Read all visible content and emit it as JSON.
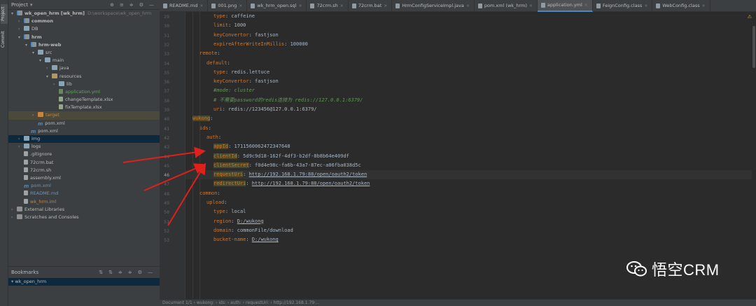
{
  "sidebar_strip": {
    "project_tab": "Project",
    "commit_tab": "Commit"
  },
  "project_panel": {
    "title": "Project",
    "tools": [
      "⊕",
      "≡",
      "≑",
      "⚙",
      "—"
    ],
    "tree": [
      {
        "depth": 0,
        "arrow": "▾",
        "icon": "folder mod",
        "label": "wk_open_hrm [wk_hrm]",
        "path": "D:\\workspace\\wk_open_hrm",
        "cls": "",
        "bold": true
      },
      {
        "depth": 1,
        "arrow": "›",
        "icon": "folder mod",
        "label": "common",
        "bold": true
      },
      {
        "depth": 1,
        "arrow": "›",
        "icon": "folder",
        "label": "DB"
      },
      {
        "depth": 1,
        "arrow": "▾",
        "icon": "folder mod",
        "label": "hrm",
        "bold": true
      },
      {
        "depth": 2,
        "arrow": "▾",
        "icon": "folder mod",
        "label": "hrm-web",
        "bold": true
      },
      {
        "depth": 3,
        "arrow": "▾",
        "icon": "folder",
        "label": "src"
      },
      {
        "depth": 4,
        "arrow": "▾",
        "icon": "folder",
        "label": "main"
      },
      {
        "depth": 5,
        "arrow": "›",
        "icon": "folder",
        "label": "java"
      },
      {
        "depth": 5,
        "arrow": "▾",
        "icon": "folder res",
        "label": "resources"
      },
      {
        "depth": 6,
        "arrow": "›",
        "icon": "folder",
        "label": "lib"
      },
      {
        "depth": 6,
        "arrow": "",
        "icon": "yml",
        "label": "application.yml",
        "cls": "green"
      },
      {
        "depth": 6,
        "arrow": "",
        "icon": "xlsx",
        "label": "changeTemplate.xlsx"
      },
      {
        "depth": 6,
        "arrow": "",
        "icon": "xlsx",
        "label": "fixTemplate.xlsx"
      },
      {
        "depth": 3,
        "arrow": "›",
        "icon": "folder orange",
        "label": "target",
        "cls": "orangeT",
        "row": "hl"
      },
      {
        "depth": 3,
        "arrow": "",
        "icon": "m",
        "label": "pom.xml"
      },
      {
        "depth": 2,
        "arrow": "",
        "icon": "m",
        "label": "pom.xml"
      },
      {
        "depth": 1,
        "arrow": "›",
        "icon": "folder",
        "label": "img",
        "row": "sel"
      },
      {
        "depth": 1,
        "arrow": "›",
        "icon": "folder",
        "label": "logs"
      },
      {
        "depth": 1,
        "arrow": "",
        "icon": "file",
        "label": ".gitignore"
      },
      {
        "depth": 1,
        "arrow": "",
        "icon": "file",
        "label": "72crm.bat"
      },
      {
        "depth": 1,
        "arrow": "",
        "icon": "file",
        "label": "72crm.sh"
      },
      {
        "depth": 1,
        "arrow": "",
        "icon": "file",
        "label": "assembly.xml"
      },
      {
        "depth": 1,
        "arrow": "",
        "icon": "m",
        "label": "pom.xml",
        "cls": "blue"
      },
      {
        "depth": 1,
        "arrow": "",
        "icon": "file",
        "label": "README.md",
        "cls": "blue"
      },
      {
        "depth": 1,
        "arrow": "",
        "icon": "file",
        "label": "wk_hrm.iml",
        "cls": "orangeT"
      },
      {
        "depth": 0,
        "arrow": "›",
        "icon": "lib",
        "label": "External Libraries"
      },
      {
        "depth": 0,
        "arrow": "›",
        "icon": "lib",
        "label": "Scratches and Consoles"
      }
    ]
  },
  "bookmarks": {
    "title": "Bookmarks",
    "tools": [
      "⇅",
      "⇅",
      "≑",
      "≑",
      "⚙",
      "—"
    ],
    "item": "wk_open_hrm"
  },
  "tabs": [
    {
      "label": "README.md",
      "active": false
    },
    {
      "label": "001.png",
      "active": false
    },
    {
      "label": "wk_hrm_open.sql",
      "active": false
    },
    {
      "label": "72crm.sh",
      "active": false
    },
    {
      "label": "72crm.bat",
      "active": false
    },
    {
      "label": "HrmConfigServiceImpl.java",
      "active": false
    },
    {
      "label": "pom.xml (wk_hrm)",
      "active": false
    },
    {
      "label": "application.yml",
      "active": true
    },
    {
      "label": "FeignConfig.class",
      "active": false
    },
    {
      "label": "WebConfig.class",
      "active": false
    }
  ],
  "editor": {
    "lines": [
      {
        "n": "29",
        "indent": 6,
        "key": "type",
        "val": "caffeine"
      },
      {
        "n": "30",
        "indent": 6,
        "key": "limit",
        "val": "1000"
      },
      {
        "n": "31",
        "indent": 6,
        "key": "keyConvertor",
        "val": "fastjson"
      },
      {
        "n": "32",
        "indent": 6,
        "key": "expireAfterWriteInMillis",
        "val": "100000"
      },
      {
        "n": "33",
        "indent": 2,
        "key": "remote",
        "val": ""
      },
      {
        "n": "34",
        "indent": 4,
        "key": "default",
        "val": ""
      },
      {
        "n": "35",
        "indent": 6,
        "key": "type",
        "val": "redis.lettuce"
      },
      {
        "n": "36",
        "indent": 6,
        "key": "keyConvertor",
        "val": "fastjson"
      },
      {
        "n": "37",
        "indent": 6,
        "comment": "#mode: cluster"
      },
      {
        "n": "38",
        "indent": 6,
        "comment": "# 不需要password的redis连接为 redis://127.0.0.1:6379/"
      },
      {
        "n": "39",
        "indent": 6,
        "key": "uri",
        "val": "redis://123456@127.0.0.1:6379/"
      },
      {
        "n": "40",
        "indent": 0,
        "key": "wukong",
        "val": "",
        "mark": true
      },
      {
        "n": "41",
        "indent": 2,
        "key": "ids",
        "val": ""
      },
      {
        "n": "42",
        "indent": 4,
        "key": "auth",
        "val": ""
      },
      {
        "n": "43",
        "indent": 6,
        "key": "appId",
        "val": "1711560062472347648",
        "mark": true
      },
      {
        "n": "44",
        "indent": 6,
        "key": "clientId",
        "val": "5d9c9d18-162f-4df3-b2df-8b8b64e409df",
        "mark": true
      },
      {
        "n": "45",
        "indent": 6,
        "key": "clientSecret",
        "val": "f0d4e98c-fa6b-43a7-87ec-a06fba038d5c",
        "mark": true
      },
      {
        "n": "46",
        "indent": 6,
        "key": "requestUri",
        "val": "http://192.168.1.79:88/open/oauth2/token",
        "link": true,
        "mark": true,
        "cur": true
      },
      {
        "n": "47",
        "indent": 6,
        "key": "redirectUri",
        "val": "http://192.168.1.79:88/open/oauth2/token",
        "link": true,
        "mark": true
      },
      {
        "n": "48",
        "indent": 2,
        "key": "common",
        "val": ""
      },
      {
        "n": "49",
        "indent": 4,
        "key": "upload",
        "val": ""
      },
      {
        "n": "50",
        "indent": 6,
        "key": "type",
        "val": "local"
      },
      {
        "n": "51",
        "indent": 6,
        "key": "region",
        "val": "D:/wukong",
        "ulval": true
      },
      {
        "n": "52",
        "indent": 6,
        "key": "domain",
        "val": "commonFile/download"
      },
      {
        "n": "53",
        "indent": 6,
        "key": "bucket-name",
        "val": "D:/wukong",
        "ulval": true
      }
    ]
  },
  "status_bar": {
    "text": "Document 1/1   ›   wukong:   ›   ids:   ›   auth:   ›   requestUri:   ›   http://192.168.1.79:..."
  },
  "watermark": {
    "text": "悟空CRM"
  },
  "colors": {
    "bg": "#2b2b2b",
    "panel": "#3c3f41",
    "key": "#cc7832",
    "comment": "#629755",
    "selection": "#0d293e",
    "arrow": "#e0201b"
  }
}
